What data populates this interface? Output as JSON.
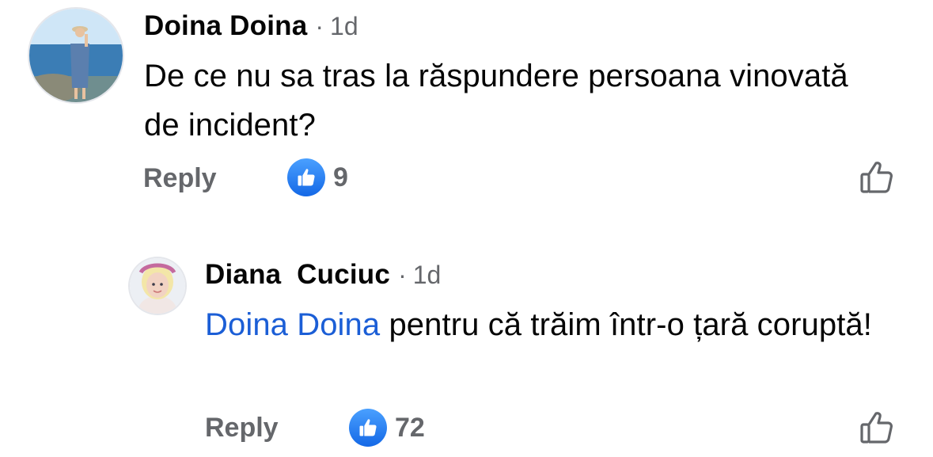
{
  "comments": [
    {
      "author": "Doina Doina",
      "separator": "·",
      "time": "1d",
      "text": "De ce nu sa tras la răspundere persoana vinovată de incident?",
      "reply_label": "Reply",
      "reaction_count": "9",
      "reaction_icon": "like-icon"
    }
  ],
  "replies": [
    {
      "author": "Diana  Cuciuc",
      "separator": "·",
      "time": "1d",
      "mention": "Doina Doina",
      "text": " pentru că trăim într-o țară coruptă!",
      "reply_label": "Reply",
      "reaction_count": "72",
      "reaction_icon": "like-icon"
    }
  ],
  "colors": {
    "mention": "#1b5ed6",
    "secondary_text": "#65676b",
    "like_badge": "#1877f2"
  }
}
